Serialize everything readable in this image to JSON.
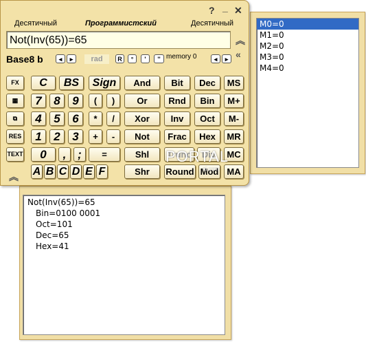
{
  "header": {
    "mode_left": "Десятичный",
    "mode_center": "Программистский",
    "mode_right": "Десятичный",
    "help": "?",
    "minimize": "_",
    "close": "✕"
  },
  "display": {
    "value": "Not(Inv(65))=65"
  },
  "toolbar": {
    "base_label": "Base8 b",
    "rad": "rad",
    "r": "R",
    "degree": "°",
    "prime": "'",
    "double_prime": "''",
    "memory_label": "memory 0"
  },
  "keys": {
    "row1": [
      "C",
      "BS",
      "Sign",
      "And",
      "Bit",
      "Dec",
      "MS"
    ],
    "row2": [
      "7",
      "8",
      "9",
      "(",
      ")",
      "Or",
      "Rnd",
      "Bin",
      "M+"
    ],
    "row3": [
      "4",
      "5",
      "6",
      "*",
      "/",
      "Xor",
      "Inv",
      "Oct",
      "M-"
    ],
    "row4": [
      "1",
      "2",
      "3",
      "+",
      "-",
      "Not",
      "Frac",
      "Hex",
      "MR"
    ],
    "row5": [
      "0",
      ",",
      ";",
      "=",
      "Shl",
      "Trunc",
      "Div",
      "MC"
    ],
    "row6": [
      "A",
      "B",
      "C",
      "D",
      "E",
      "F",
      "Shr",
      "Round",
      "Mod",
      "MA"
    ],
    "side_icons": [
      "FX",
      "RES",
      "TEXT"
    ]
  },
  "memory": {
    "items": [
      "M0=0",
      "M1=0",
      "M2=0",
      "M3=0",
      "M4=0"
    ],
    "selected_index": 0
  },
  "history": {
    "lines": [
      "Not(Inv(65))=65",
      "Bin=0100 0001",
      "Oct=101",
      "Dec=65",
      "Hex=41"
    ]
  },
  "watermark": {
    "text": "PORTAL",
    "small": "al.com"
  }
}
